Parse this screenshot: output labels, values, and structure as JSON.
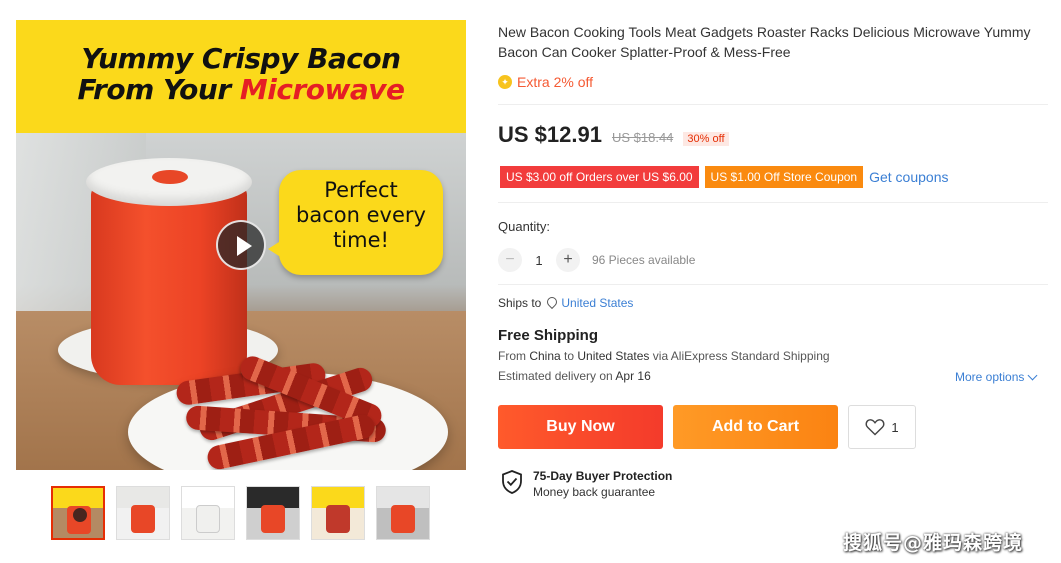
{
  "main_image": {
    "banner_line1": "Yummy Crispy Bacon",
    "banner_line2_prefix": "From Your ",
    "banner_line2_highlight": "Microwave",
    "bubble_line1": "Perfect",
    "bubble_line2": "bacon every",
    "bubble_line3": "time!",
    "banner_color": "#fbd91b",
    "highlight_color": "#e51e25"
  },
  "thumbnails": [
    {
      "label": "thumbnail-1",
      "active": true,
      "top": "#fbd91b",
      "bottom": "#b48a63"
    },
    {
      "label": "thumbnail-2",
      "active": false,
      "top": "#e8e8e6",
      "bottom": "#d0412a"
    },
    {
      "label": "thumbnail-3",
      "active": false,
      "top": "#ffffff",
      "bottom": "#f2f2f0"
    },
    {
      "label": "thumbnail-4",
      "active": false,
      "top": "#2a2a2a",
      "bottom": "#cfcfcf"
    },
    {
      "label": "thumbnail-5",
      "active": false,
      "top": "#fbd91b",
      "bottom": "#c0392b"
    },
    {
      "label": "thumbnail-6",
      "active": false,
      "top": "#e5e5e5",
      "bottom": "#bfbfbf"
    }
  ],
  "product": {
    "title": "New Bacon Cooking Tools Meat Gadgets Roaster Racks Delicious Microwave Yummy Bacon Can Cooker Splatter-Proof & Mess-Free",
    "extra_off": "Extra 2% off",
    "price": "US $12.91",
    "original_price": "US $18.44",
    "discount": "30% off"
  },
  "coupons": {
    "coupon1": "US $3.00 off Orders over US $6.00",
    "coupon2": "US $1.00 Off Store Coupon",
    "get_coupons": "Get coupons"
  },
  "quantity": {
    "label": "Quantity:",
    "minus": "−",
    "value": "1",
    "plus": "+",
    "available": "96 Pieces available"
  },
  "shipping": {
    "ships_to_label": "Ships to",
    "country": "United States",
    "free_shipping": "Free Shipping",
    "route_from": "From ",
    "route_origin": "China",
    "route_to": " to ",
    "route_dest": "United States",
    "route_via": " via AliExpress Standard Shipping",
    "delivery_prefix": "Estimated delivery on ",
    "delivery_date": "Apr 16",
    "more_options": "More options"
  },
  "actions": {
    "buy_now": "Buy Now",
    "add_to_cart": "Add to Cart",
    "wishlist_count": "1"
  },
  "protection": {
    "title": "75-Day Buyer Protection",
    "subtitle": "Money back guarantee"
  },
  "watermark": "搜狐号@雅玛森跨境",
  "colors": {
    "accent_red": "#e62e04",
    "buy_now": "#f43b2b",
    "add_to_cart": "#fb8312",
    "link_blue": "#3b7fd4"
  }
}
